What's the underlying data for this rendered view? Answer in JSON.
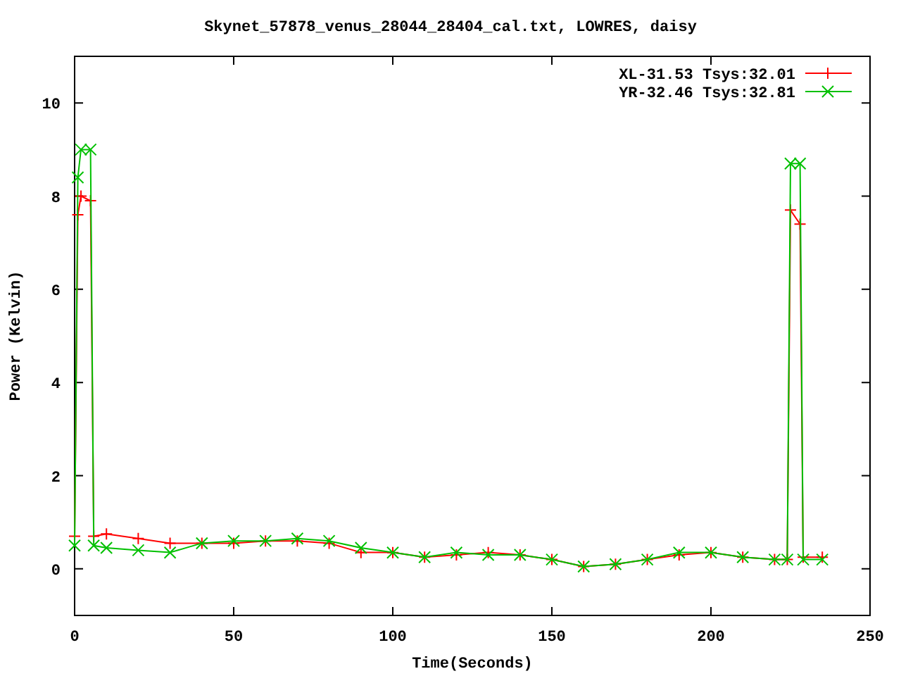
{
  "chart_data": {
    "type": "line",
    "title": "Skynet_57878_venus_28044_28404_cal.txt, LOWRES, daisy",
    "xlabel": "Time(Seconds)",
    "ylabel": "Power (Kelvin)",
    "xlim": [
      0,
      250
    ],
    "ylim": [
      -1,
      11
    ],
    "xticks": [
      0,
      50,
      100,
      150,
      200,
      250
    ],
    "yticks": [
      0,
      2,
      4,
      6,
      8,
      10
    ],
    "legend": true,
    "x": [
      0,
      1,
      2,
      5,
      6,
      10,
      20,
      30,
      40,
      50,
      60,
      70,
      80,
      90,
      100,
      110,
      120,
      130,
      140,
      150,
      160,
      170,
      180,
      190,
      200,
      210,
      220,
      224,
      225,
      228,
      229,
      235
    ],
    "series": [
      {
        "name": "XL-31.53 Tsys:32.01",
        "color": "#ff0000",
        "marker": "plus",
        "values": [
          0.7,
          7.6,
          8.0,
          7.9,
          0.7,
          0.75,
          0.65,
          0.55,
          0.55,
          0.55,
          0.6,
          0.6,
          0.55,
          0.35,
          0.35,
          0.25,
          0.3,
          0.35,
          0.3,
          0.2,
          0.05,
          0.1,
          0.2,
          0.3,
          0.35,
          0.25,
          0.2,
          0.2,
          7.7,
          7.4,
          0.25,
          0.25
        ]
      },
      {
        "name": "YR-32.46 Tsys:32.81",
        "color": "#00c000",
        "marker": "cross",
        "values": [
          0.5,
          8.4,
          9.0,
          9.0,
          0.5,
          0.45,
          0.4,
          0.35,
          0.55,
          0.6,
          0.6,
          0.65,
          0.6,
          0.45,
          0.35,
          0.25,
          0.35,
          0.3,
          0.3,
          0.2,
          0.05,
          0.1,
          0.2,
          0.35,
          0.35,
          0.25,
          0.2,
          0.2,
          8.7,
          8.7,
          0.2,
          0.2
        ]
      }
    ]
  }
}
